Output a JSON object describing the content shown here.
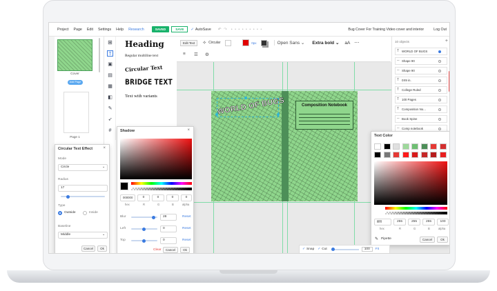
{
  "topbar": {
    "menu": [
      "Project",
      "Page",
      "Edit",
      "Settings",
      "Help",
      "Research"
    ],
    "saved_label": "SAVED",
    "save_label": "SAVE",
    "autosave_label": "AutoSave",
    "doc_title": "Bug Cover For Training Video cover and interior",
    "logout_label": "Log Out"
  },
  "pages": {
    "cover_label": "Cover",
    "add_page_label": "Add Page",
    "page1_label": "Page 1"
  },
  "text_panel": {
    "heading": "Heading",
    "regular": "Regular multiline text",
    "circular": "Circular Text",
    "bridge": "BRIDGE TEXT",
    "variants": "Text with variants"
  },
  "toolbar": {
    "edit_text_label": "Edit Text",
    "circular_label": "Circular",
    "spacing_value": "0px",
    "font_family": "Open Sans",
    "font_weight": "Extra bold",
    "case_label": "aA"
  },
  "layers": {
    "count_label": "10 objects",
    "items": [
      "WORLD OF BUGS",
      "Shape 90",
      "Shape 90",
      "0X9 in.",
      "College Ruled",
      "100 Pages",
      "Composition No...",
      "Book Spine",
      "Comp notebook"
    ]
  },
  "cover": {
    "title": "WORLD OF BUGS",
    "notebook_title": "Composition Notebook"
  },
  "circular_dialog": {
    "title": "Circular Text Effect",
    "mode_label": "Mode",
    "mode_value": "Circle",
    "radius_label": "Radius",
    "radius_value": "17",
    "type_label": "Type",
    "type_outside": "Outside",
    "type_inside": "Inside",
    "baseline_label": "Baseline",
    "baseline_value": "Middle",
    "cancel_label": "Cancel",
    "ok_label": "Ok"
  },
  "shadow_dialog": {
    "title": "Shadow",
    "hex_value": "000000",
    "r_value": "0",
    "g_value": "0",
    "b_value": "0",
    "alpha_value": "0",
    "hex_label": "hex",
    "r_label": "R",
    "g_label": "G",
    "b_label": "B",
    "alpha_label": "alpha",
    "blur_label": "Blur",
    "blur_value": "28",
    "left_label": "Left",
    "left_value": "0",
    "top_label": "Top",
    "top_value": "0",
    "reset_label": "Reset",
    "clear_label": "Clear",
    "cancel_label": "Cancel",
    "ok_label": "Ok"
  },
  "text_color_dialog": {
    "title": "Text Color",
    "hex_value": "ffffff",
    "r_value": "255",
    "g_value": "255",
    "b_value": "255",
    "alpha_value": "100",
    "hex_label": "hex",
    "r_label": "R",
    "g_label": "G",
    "b_label": "B",
    "alpha_label": "alpha",
    "pipette_label": "Pipette",
    "cancel_label": "Cancel",
    "ok_label": "Ok",
    "swatches": [
      "#ffffff",
      "#000000",
      "#e0e0e0",
      "#9ed99b",
      "#6fbf73",
      "#4d8f58",
      "#e53935",
      "#d32f2f",
      "#000000",
      "#777777",
      "#e53935",
      "#ff1a1a",
      "#d81b1b",
      "#c62828",
      "#b71c1c",
      "#e91e1e"
    ]
  },
  "bottom_bar": {
    "snap_label": "Snap",
    "cut_label": "Cut",
    "zoom_value": "100",
    "fit_label": "Fit"
  },
  "colors": {
    "accent_green": "#19b26b",
    "accent_blue": "#3b7be0",
    "cover_green": "#8fd68c"
  }
}
